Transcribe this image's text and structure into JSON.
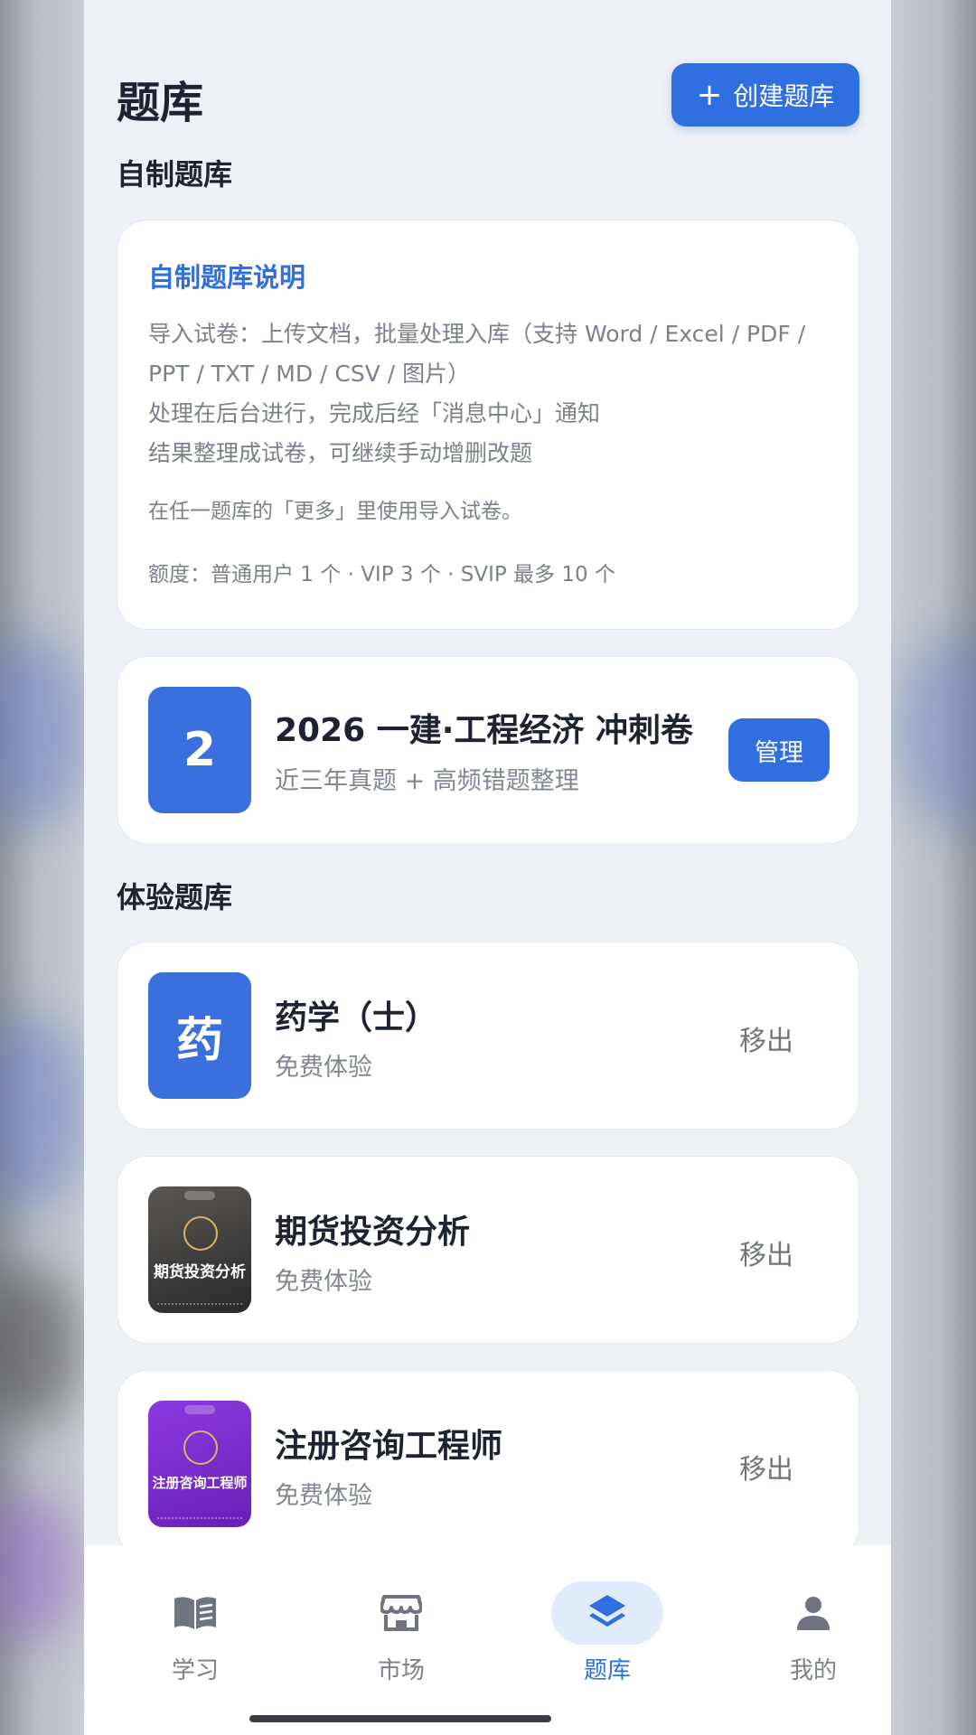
{
  "header": {
    "title": "题库",
    "create_button": "创建题库"
  },
  "sections": {
    "custom": "自制题库",
    "trial": "体验题库"
  },
  "info_card": {
    "title": "自制题库说明",
    "lines": [
      "导入试卷：上传文档，批量处理入库（支持 Word / Excel / PDF / PPT / TXT / MD / CSV / 图片）",
      "处理在后台进行，完成后经「消息中心」通知",
      "结果整理成试卷，可继续手动增删改题"
    ],
    "note": "在任一题库的「更多」里使用导入试卷。",
    "quota": "额度：普通用户 1 个 · VIP 3 个 · SVIP 最多 10 个"
  },
  "custom_bank": {
    "thumb": "2",
    "title": "2026 一建·工程经济 冲刺卷",
    "subtitle": "近三年真题 + 高频错题整理",
    "manage_label": "管理"
  },
  "trial_banks": [
    {
      "thumb": "药",
      "title": "药学（士）",
      "subtitle": "免费体验",
      "action": "移出"
    },
    {
      "cover_text": "期货投资分析",
      "title": "期货投资分析",
      "subtitle": "免费体验",
      "action": "移出"
    },
    {
      "cover_text": "注册咨询工程师",
      "title": "注册咨询工程师",
      "subtitle": "免费体验",
      "action": "移出"
    }
  ],
  "nav": {
    "items": [
      {
        "label": "学习",
        "icon": "book-icon"
      },
      {
        "label": "市场",
        "icon": "store-icon"
      },
      {
        "label": "题库",
        "icon": "layers-icon",
        "active": true
      },
      {
        "label": "我的",
        "icon": "person-icon"
      }
    ]
  },
  "colors": {
    "accent": "#2f6fe0",
    "background": "#eef1f6",
    "text": "#1d2330",
    "muted": "#7a808c"
  }
}
